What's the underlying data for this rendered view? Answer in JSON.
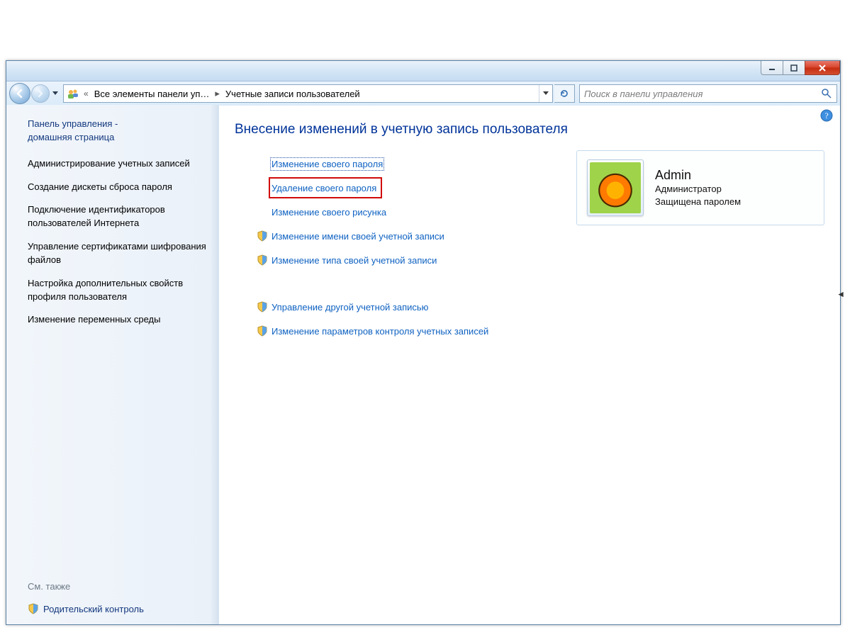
{
  "breadcrumb": {
    "parent": "Все элементы панели уп…",
    "current": "Учетные записи пользователей"
  },
  "search": {
    "placeholder": "Поиск в панели управления"
  },
  "sidebar": {
    "home_line1": "Панель управления -",
    "home_line2": "домашняя страница",
    "tasks": [
      "Администрирование учетных записей",
      "Создание дискеты сброса пароля",
      "Подключение идентификаторов пользователей Интернета",
      "Управление сертификатами шифрования файлов",
      "Настройка дополнительных свойств профиля пользователя",
      "Изменение переменных среды"
    ],
    "see_also_label": "См. также",
    "see_also_items": [
      "Родительский контроль"
    ]
  },
  "main": {
    "title": "Внесение изменений в учетную запись пользователя",
    "actions_primary": [
      {
        "label": "Изменение своего пароля",
        "shield": false,
        "focused": true,
        "highlight": false
      },
      {
        "label": "Удаление своего пароля",
        "shield": false,
        "focused": false,
        "highlight": true
      },
      {
        "label": "Изменение своего рисунка",
        "shield": false,
        "focused": false,
        "highlight": false
      },
      {
        "label": "Изменение имени своей учетной записи",
        "shield": true,
        "focused": false,
        "highlight": false
      },
      {
        "label": "Изменение типа своей учетной записи",
        "shield": true,
        "focused": false,
        "highlight": false
      }
    ],
    "actions_secondary": [
      {
        "label": "Управление другой учетной записью",
        "shield": true
      },
      {
        "label": "Изменение параметров контроля учетных записей",
        "shield": true
      }
    ]
  },
  "account": {
    "name": "Admin",
    "role": "Администратор",
    "status": "Защищена паролем"
  }
}
